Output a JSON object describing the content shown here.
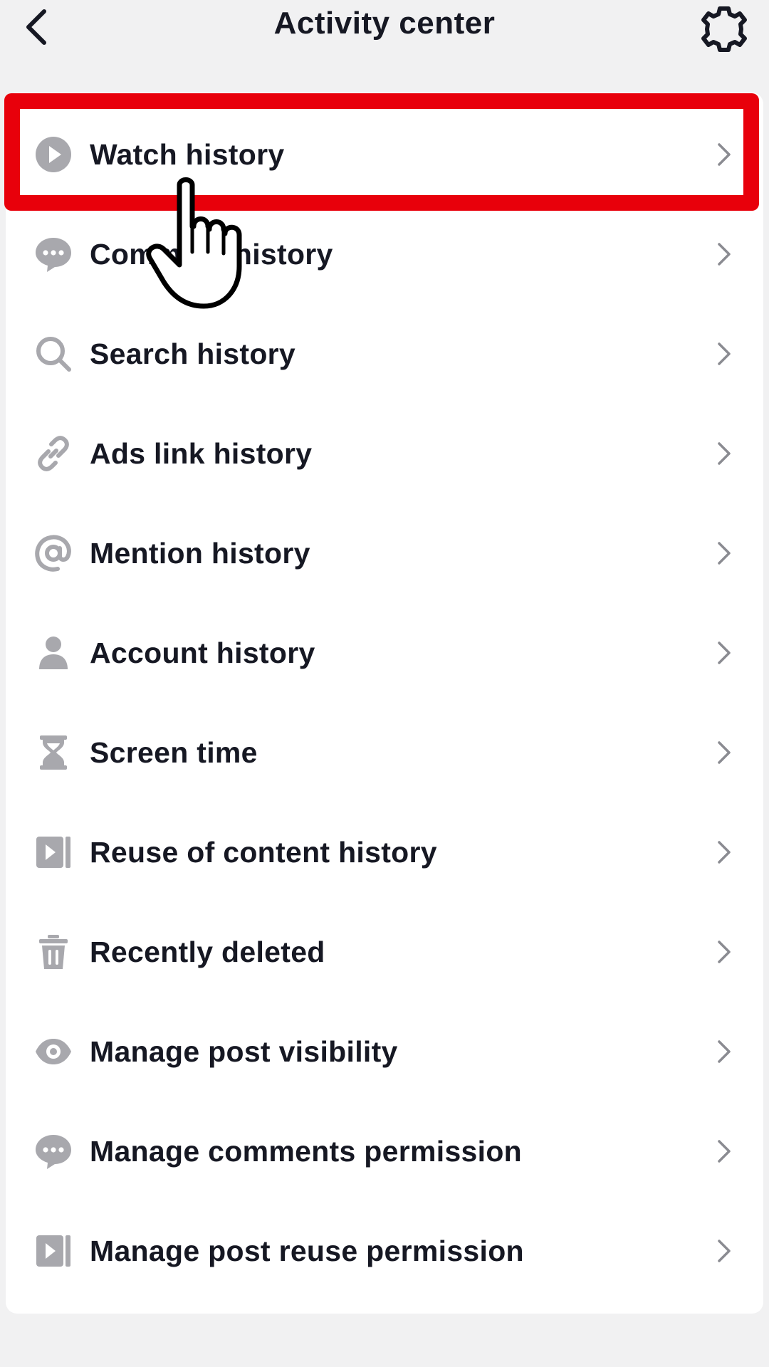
{
  "header": {
    "title": "Activity center",
    "back_icon": "chevron-left-icon",
    "settings_icon": "gear-icon"
  },
  "menu": {
    "items": [
      {
        "label": "Watch history",
        "icon": "play-circle-icon"
      },
      {
        "label": "Comment history",
        "icon": "comment-icon"
      },
      {
        "label": "Search history",
        "icon": "search-icon"
      },
      {
        "label": "Ads link history",
        "icon": "link-icon"
      },
      {
        "label": "Mention history",
        "icon": "at-icon"
      },
      {
        "label": "Account history",
        "icon": "person-icon"
      },
      {
        "label": "Screen time",
        "icon": "hourglass-icon"
      },
      {
        "label": "Reuse of content history",
        "icon": "video-reuse-icon"
      },
      {
        "label": "Recently deleted",
        "icon": "trash-icon"
      },
      {
        "label": "Manage post visibility",
        "icon": "eye-icon"
      },
      {
        "label": "Manage comments permission",
        "icon": "comment-icon"
      },
      {
        "label": "Manage post reuse permission",
        "icon": "video-reuse-icon"
      }
    ]
  },
  "colors": {
    "highlight": "#e8000b",
    "icon_gray": "#a8a8ad",
    "text": "#161823",
    "background": "#f1f1f2"
  }
}
